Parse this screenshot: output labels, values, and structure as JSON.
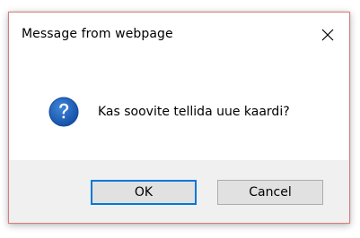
{
  "dialog": {
    "title": "Message from webpage",
    "message": "Kas soovite tellida uue kaardi?",
    "icon": "question-icon",
    "buttons": {
      "ok_label": "OK",
      "cancel_label": "Cancel"
    }
  },
  "colors": {
    "dialog_border": "#d87c7c",
    "footer_bg": "#f0f0f0",
    "button_bg": "#e1e1e1",
    "default_button_border": "#0078d7",
    "icon_blue": "#1c62b9"
  }
}
